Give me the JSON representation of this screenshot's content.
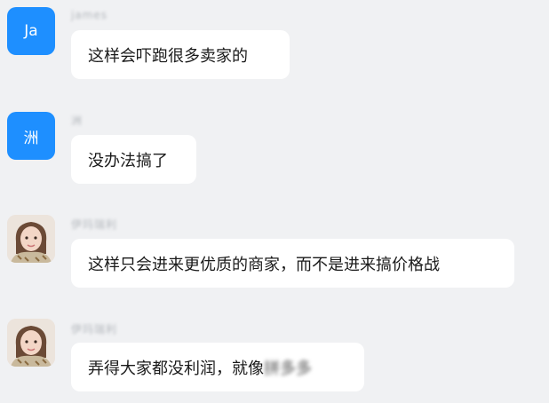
{
  "messages": [
    {
      "avatar_text": "Ja",
      "sender": "james",
      "text": "这样会吓跑很多卖家的"
    },
    {
      "avatar_text": "洲",
      "sender": "洲",
      "text": "没办法搞了"
    },
    {
      "avatar_text": "",
      "sender": "伊玛瑞利",
      "text": "这样只会进来更优质的商家，而不是进来搞价格战"
    },
    {
      "avatar_text": "",
      "sender": "伊玛瑞利",
      "text": "弄得大家都没利润，就像",
      "text_blurred": "拼多多"
    }
  ],
  "colors": {
    "background": "#f0f1f3",
    "avatar_blue": "#1e8fff",
    "bubble": "#ffffff"
  }
}
